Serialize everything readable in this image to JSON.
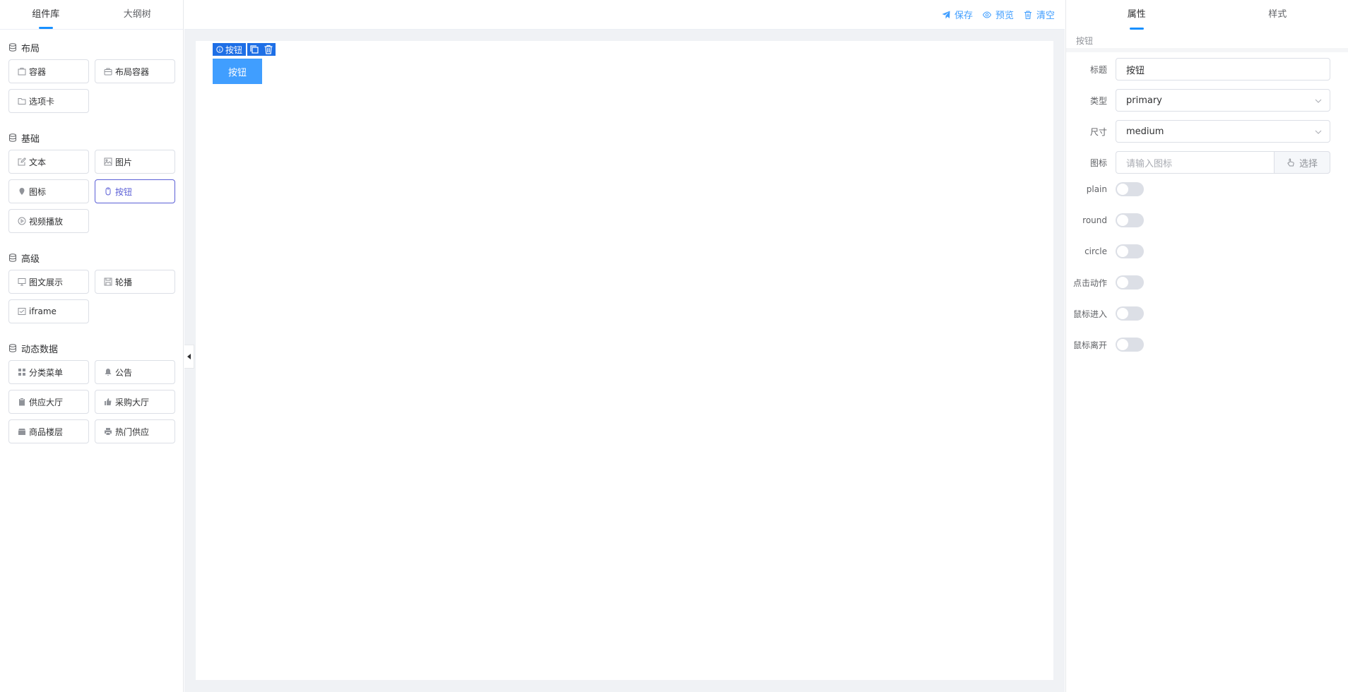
{
  "left": {
    "tabs": [
      "组件库",
      "大纲树"
    ],
    "groups": [
      {
        "title": "布局",
        "items": [
          {
            "label": "容器",
            "icon": "box-icon"
          },
          {
            "label": "布局容器",
            "icon": "briefcase-icon"
          },
          {
            "label": "选项卡",
            "icon": "folder-icon"
          }
        ]
      },
      {
        "title": "基础",
        "items": [
          {
            "label": "文本",
            "icon": "edit-icon"
          },
          {
            "label": "图片",
            "icon": "picture-icon"
          },
          {
            "label": "图标",
            "icon": "location-icon"
          },
          {
            "label": "按钮",
            "icon": "mouse-icon"
          },
          {
            "label": "视频播放",
            "icon": "video-play-icon"
          }
        ]
      },
      {
        "title": "高级",
        "items": [
          {
            "label": "图文展示",
            "icon": "monitor-icon"
          },
          {
            "label": "轮播",
            "icon": "save-icon"
          },
          {
            "label": "iframe",
            "icon": "frame-icon"
          }
        ]
      },
      {
        "title": "动态数据",
        "items": [
          {
            "label": "分类菜单",
            "icon": "grid-icon"
          },
          {
            "label": "公告",
            "icon": "bell-icon"
          },
          {
            "label": "供应大厅",
            "icon": "clipboard-icon"
          },
          {
            "label": "采购大厅",
            "icon": "thumb-icon"
          },
          {
            "label": "商品楼层",
            "icon": "shop-icon"
          },
          {
            "label": "热门供应",
            "icon": "printer-icon"
          }
        ]
      }
    ]
  },
  "toolbar": {
    "save": "保存",
    "preview": "预览",
    "clear": "清空"
  },
  "canvas": {
    "selected_tag": "按钮",
    "button_label": "按钮"
  },
  "right": {
    "tabs": [
      "属性",
      "样式"
    ],
    "subtitle": "按钮",
    "fields": {
      "title_label": "标题",
      "title_value": "按钮",
      "type_label": "类型",
      "type_value": "primary",
      "size_label": "尺寸",
      "size_value": "medium",
      "icon_label": "图标",
      "icon_placeholder": "请输入图标",
      "icon_button": "选择"
    },
    "switches": [
      {
        "label": "plain",
        "on": false
      },
      {
        "label": "round",
        "on": false
      },
      {
        "label": "circle",
        "on": false
      },
      {
        "label": "点击动作",
        "on": false
      },
      {
        "label": "鼠标进入",
        "on": false
      },
      {
        "label": "鼠标离开",
        "on": false
      }
    ]
  },
  "colors": {
    "accent": "#409eff",
    "selected_border": "#5b5fd6",
    "tag_bg": "#1e6fe6"
  }
}
